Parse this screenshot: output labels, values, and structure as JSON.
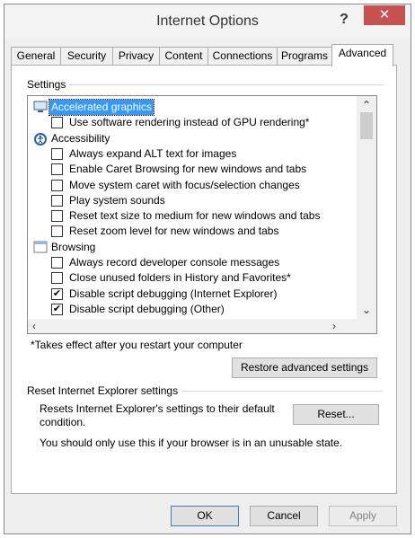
{
  "window": {
    "title": "Internet Options",
    "help_glyph": "?",
    "close_glyph": "✕"
  },
  "tabs": [
    "General",
    "Security",
    "Privacy",
    "Content",
    "Connections",
    "Programs",
    "Advanced"
  ],
  "settings": {
    "group_label": "Settings",
    "items": [
      {
        "type": "category",
        "label": "Accelerated graphics",
        "icon": "monitor-icon",
        "selected": true
      },
      {
        "type": "checkbox",
        "label": "Use software rendering instead of GPU rendering*",
        "checked": false
      },
      {
        "type": "category",
        "label": "Accessibility",
        "icon": "accessibility-icon"
      },
      {
        "type": "checkbox",
        "label": "Always expand ALT text for images",
        "checked": false
      },
      {
        "type": "checkbox",
        "label": "Enable Caret Browsing for new windows and tabs",
        "checked": false
      },
      {
        "type": "checkbox",
        "label": "Move system caret with focus/selection changes",
        "checked": false
      },
      {
        "type": "checkbox",
        "label": "Play system sounds",
        "checked": false
      },
      {
        "type": "checkbox",
        "label": "Reset text size to medium for new windows and tabs",
        "checked": false
      },
      {
        "type": "checkbox",
        "label": "Reset zoom level for new windows and tabs",
        "checked": false
      },
      {
        "type": "category",
        "label": "Browsing",
        "icon": "browser-window-icon"
      },
      {
        "type": "checkbox",
        "label": "Always record developer console messages",
        "checked": false
      },
      {
        "type": "checkbox",
        "label": "Close unused folders in History and Favorites*",
        "checked": false
      },
      {
        "type": "checkbox",
        "label": "Disable script debugging (Internet Explorer)",
        "checked": true
      },
      {
        "type": "checkbox",
        "label": "Disable script debugging (Other)",
        "checked": true
      }
    ],
    "note": "*Takes effect after you restart your computer",
    "restore_button": "Restore advanced settings"
  },
  "reset": {
    "group_label": "Reset Internet Explorer settings",
    "description": "Resets Internet Explorer's settings to their default condition.",
    "reset_button": "Reset...",
    "warning": "You should only use this if your browser is in an unusable state."
  },
  "footer": {
    "ok": "OK",
    "cancel": "Cancel",
    "apply": "Apply"
  },
  "colors": {
    "close_red": "#c75050",
    "selection_blue": "#3399ff"
  }
}
